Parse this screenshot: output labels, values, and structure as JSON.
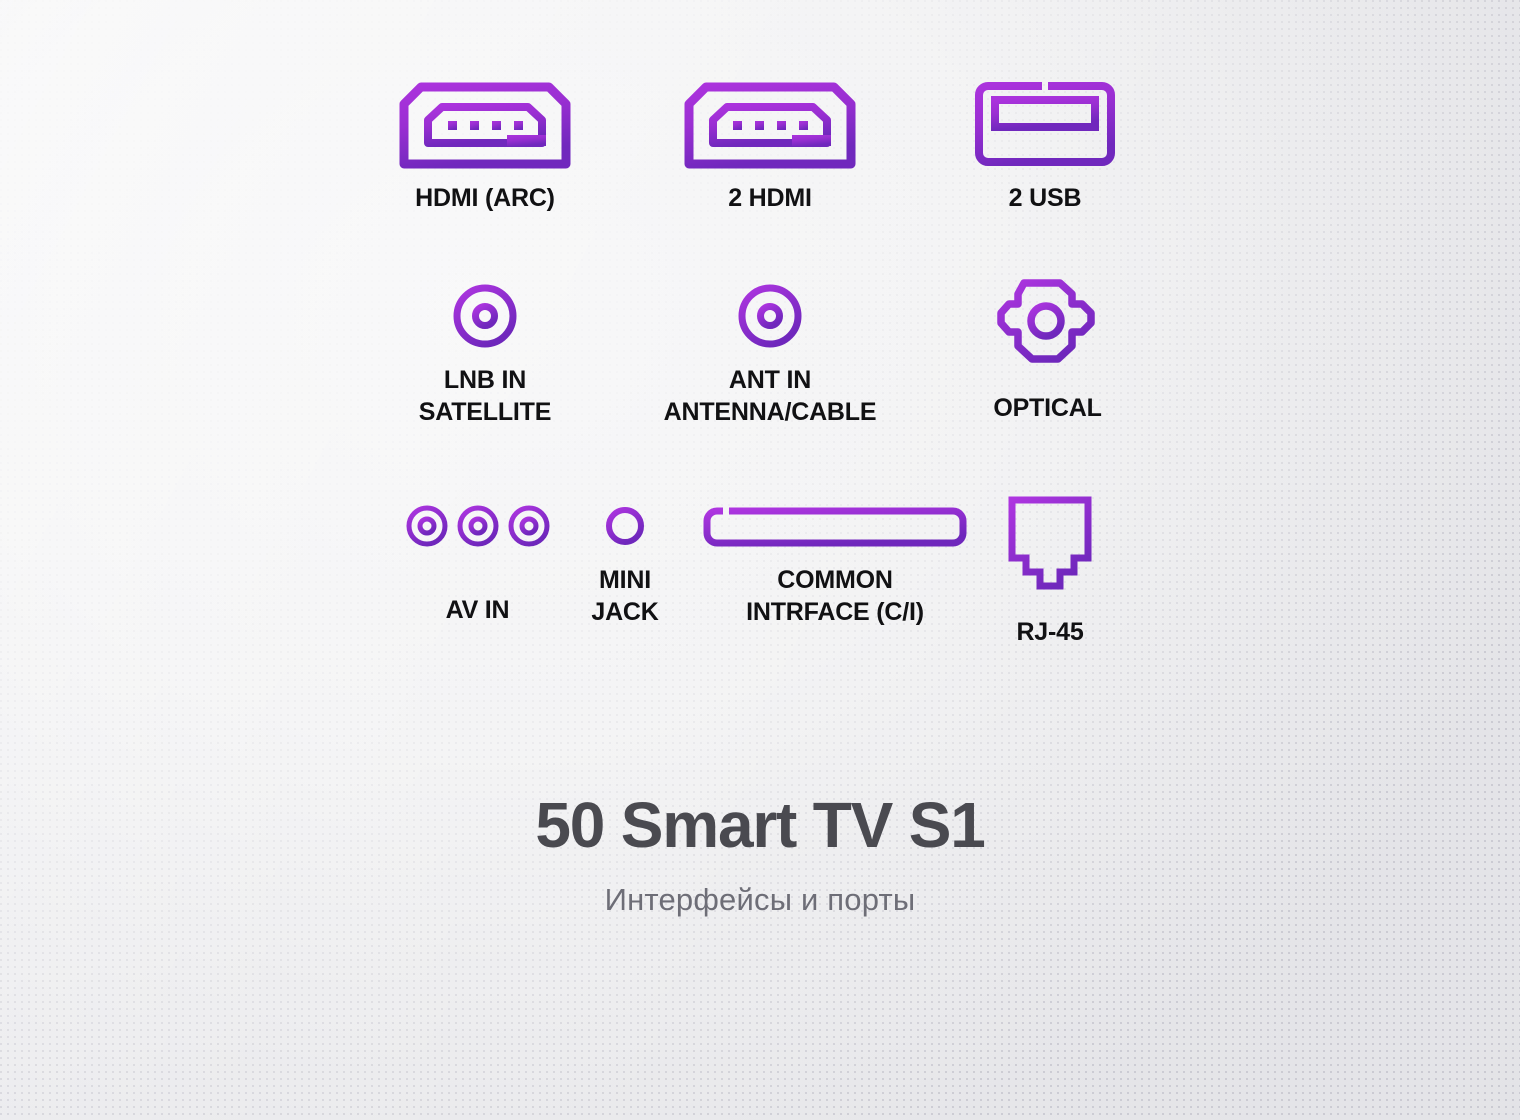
{
  "theme": {
    "background_color": "#f3f3f4",
    "accent_color_start": "#a32fd4",
    "accent_color_end": "#7629c2",
    "label_color": "#111113",
    "title_color": "#4a4a50",
    "subtitle_color": "#6e6e77"
  },
  "ports": {
    "rows": [
      {
        "items": [
          {
            "icon": "hdmi-port-icon",
            "label": "HDMI (ARC)"
          },
          {
            "icon": "hdmi-port-icon",
            "label": "2 HDMI"
          },
          {
            "icon": "usb-port-icon",
            "label": "2 USB"
          }
        ]
      },
      {
        "items": [
          {
            "icon": "coaxial-port-icon",
            "label": "LNB IN\nSATELLITE"
          },
          {
            "icon": "coaxial-port-icon",
            "label": "ANT IN\nANTENNA/CABLE"
          },
          {
            "icon": "optical-toslink-port-icon",
            "label": "OPTICAL"
          }
        ]
      },
      {
        "items": [
          {
            "icon": "rca-av-port-icon",
            "label": "AV IN"
          },
          {
            "icon": "mini-jack-port-icon",
            "label": "MINI\nJACK"
          },
          {
            "icon": "common-interface-slot-icon",
            "label": "COMMON\nINTRFACE (C/I)"
          },
          {
            "icon": "rj45-ethernet-port-icon",
            "label": "RJ-45"
          }
        ]
      }
    ]
  },
  "footer": {
    "title": "50 Smart TV S1",
    "subtitle": "Интерфейсы и порты"
  }
}
